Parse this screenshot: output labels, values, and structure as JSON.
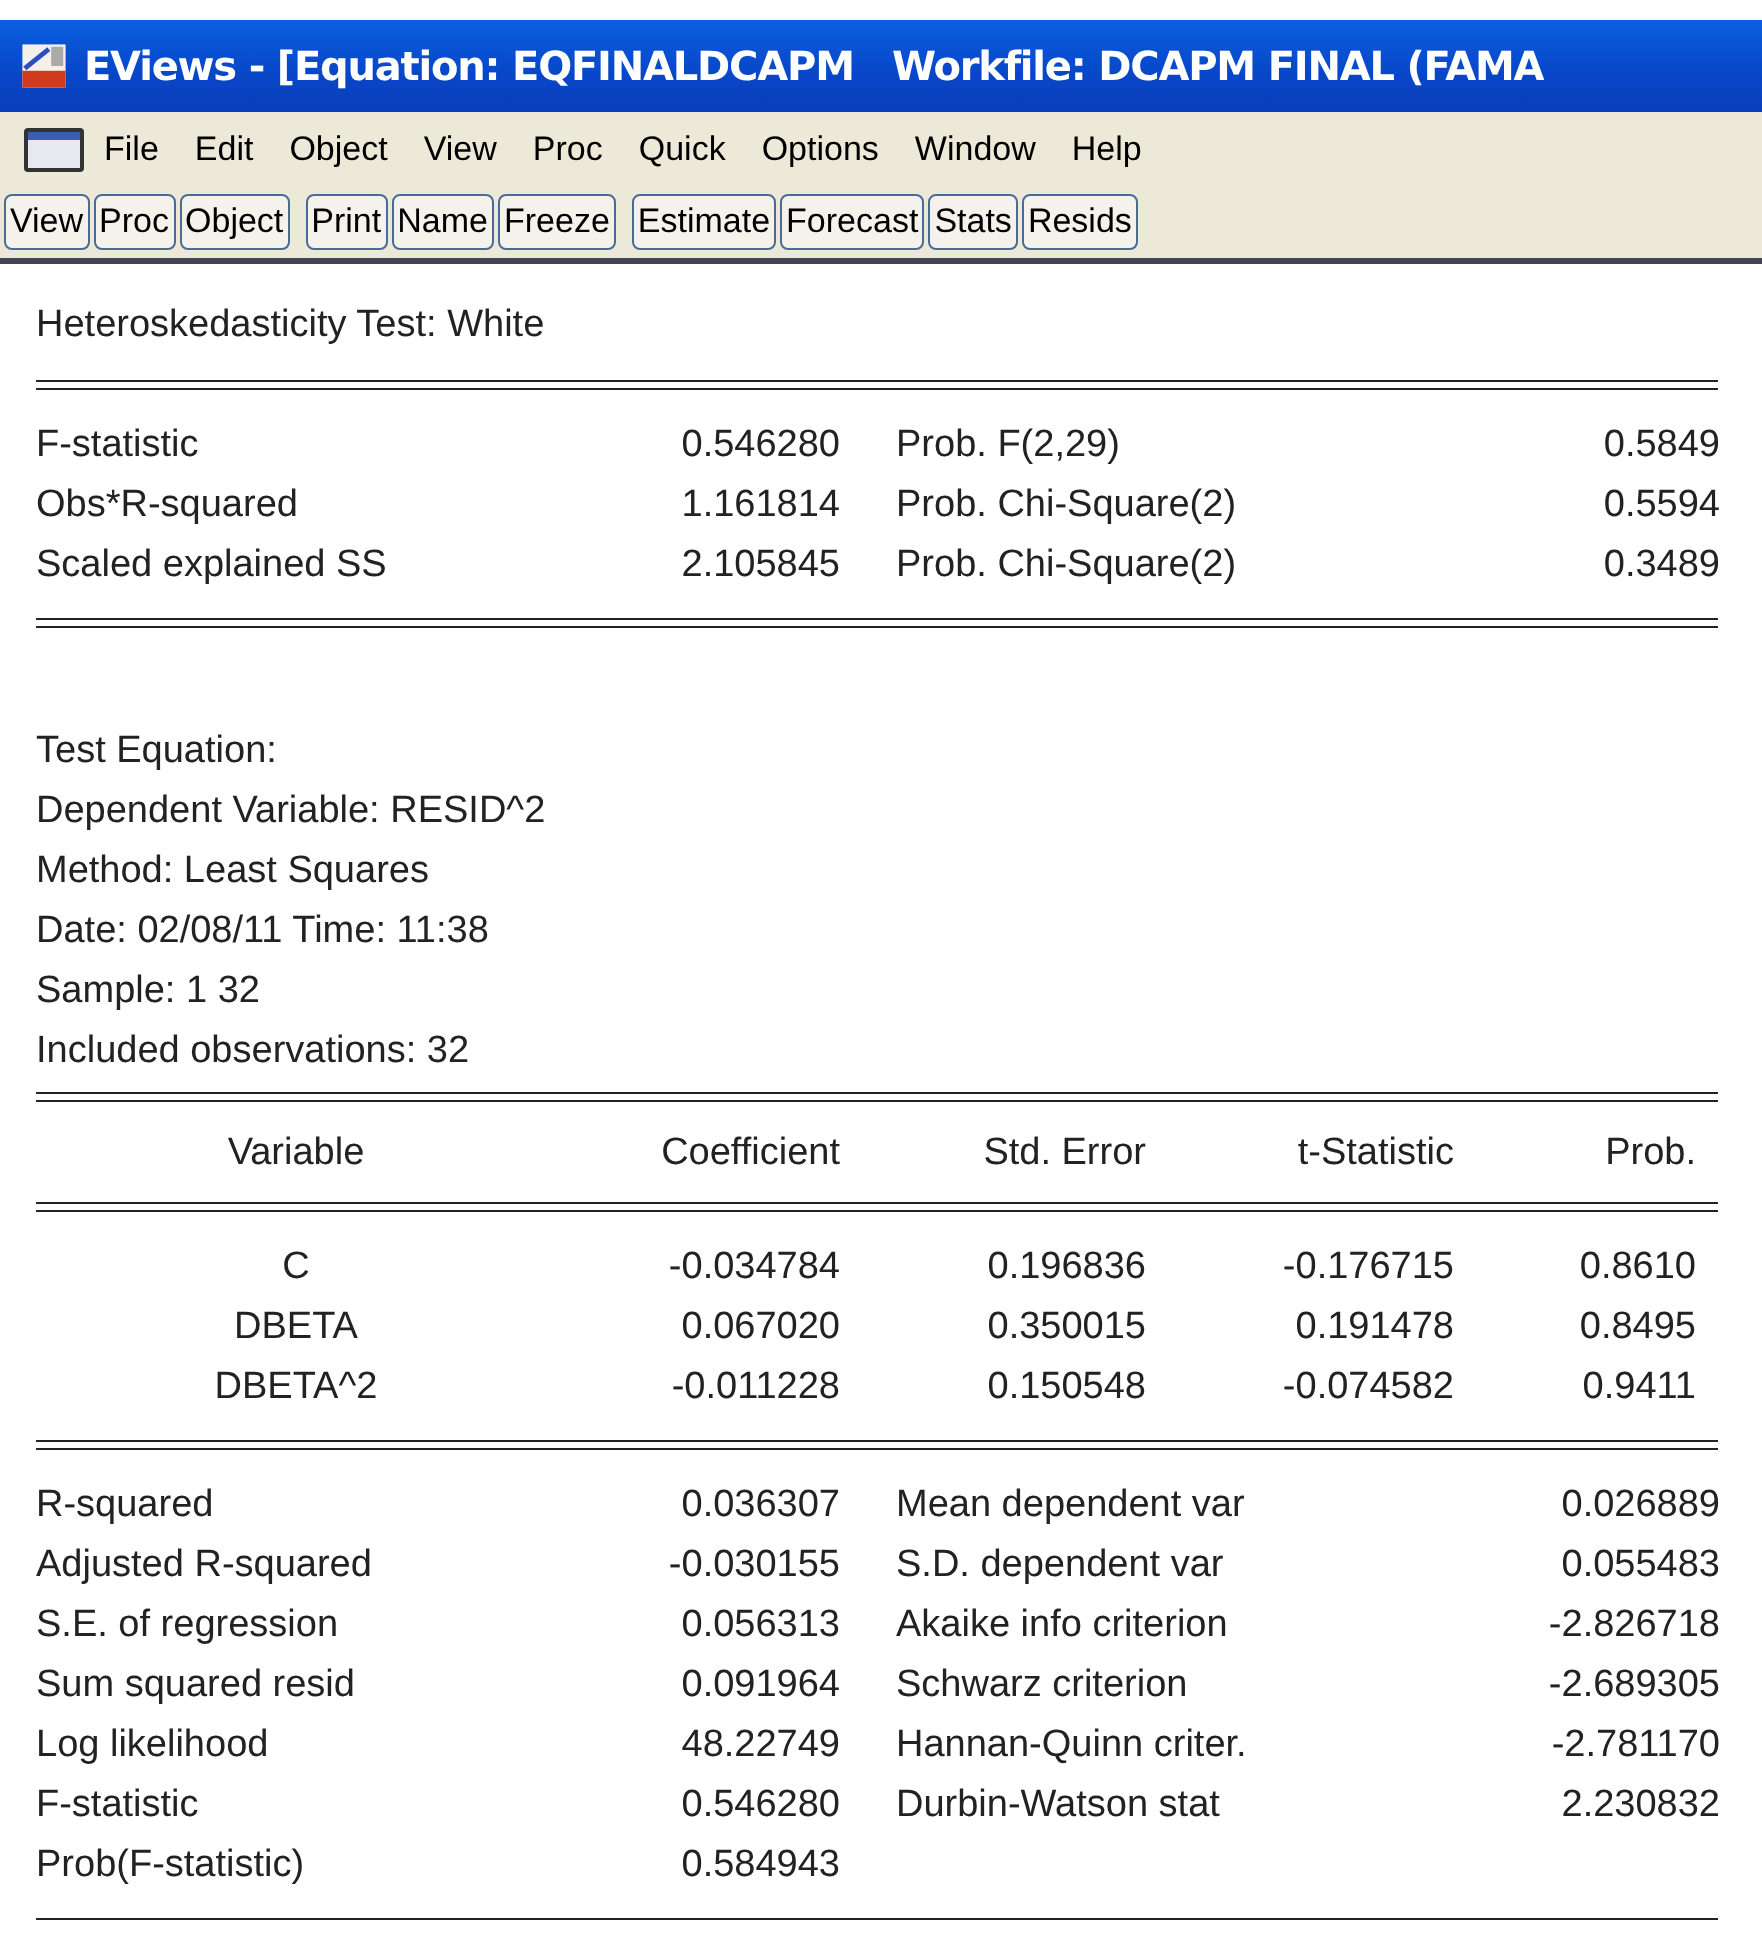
{
  "window": {
    "title": "EViews - [Equation: EQFINALDCAPM   Workfile: DCAPM FINAL (FAMA"
  },
  "menu": [
    "File",
    "Edit",
    "Object",
    "View",
    "Proc",
    "Quick",
    "Options",
    "Window",
    "Help"
  ],
  "toolbar": [
    [
      "View",
      "Proc",
      "Object"
    ],
    [
      "Print",
      "Name",
      "Freeze"
    ],
    [
      "Estimate",
      "Forecast",
      "Stats",
      "Resids"
    ]
  ],
  "output": {
    "heading": "Heteroskedasticity Test: White",
    "test_stats": [
      {
        "label": "F-statistic",
        "value": "0.546280",
        "prob_label": "Prob. F(2,29)",
        "prob": "0.5849"
      },
      {
        "label": "Obs*R-squared",
        "value": "1.161814",
        "prob_label": "Prob. Chi-Square(2)",
        "prob": "0.5594"
      },
      {
        "label": "Scaled explained SS",
        "value": "2.105845",
        "prob_label": "Prob. Chi-Square(2)",
        "prob": "0.3489"
      }
    ],
    "info_lines": [
      "Test Equation:",
      "Dependent Variable: RESID^2",
      "Method: Least Squares",
      "Date: 02/08/11   Time: 11:38",
      "Sample: 1 32",
      "Included observations: 32"
    ],
    "coef_table": {
      "columns": [
        "Variable",
        "Coefficient",
        "Std. Error",
        "t-Statistic",
        "Prob."
      ],
      "rows": [
        [
          "C",
          "-0.034784",
          "0.196836",
          "-0.176715",
          "0.8610"
        ],
        [
          "DBETA",
          "0.067020",
          "0.350015",
          "0.191478",
          "0.8495"
        ],
        [
          "DBETA^2",
          "-0.011228",
          "0.150548",
          "-0.074582",
          "0.9411"
        ]
      ]
    },
    "summary": [
      {
        "label": "R-squared",
        "value": "0.036307",
        "label_2": "Mean dependent var",
        "value_2": "0.026889"
      },
      {
        "label": "Adjusted R-squared",
        "value": "-0.030155",
        "label_2": "S.D. dependent var",
        "value_2": "0.055483"
      },
      {
        "label": "S.E. of regression",
        "value": "0.056313",
        "label_2": "Akaike info criterion",
        "value_2": "-2.826718"
      },
      {
        "label": "Sum squared resid",
        "value": "0.091964",
        "label_2": "Schwarz criterion",
        "value_2": "-2.689305"
      },
      {
        "label": "Log likelihood",
        "value": "48.22749",
        "label_2": "Hannan-Quinn criter.",
        "value_2": "-2.781170"
      },
      {
        "label": "F-statistic",
        "value": "0.546280",
        "label_2": "Durbin-Watson stat",
        "value_2": "2.230832"
      },
      {
        "label": "Prob(F-statistic)",
        "value": "0.584943"
      }
    ]
  }
}
